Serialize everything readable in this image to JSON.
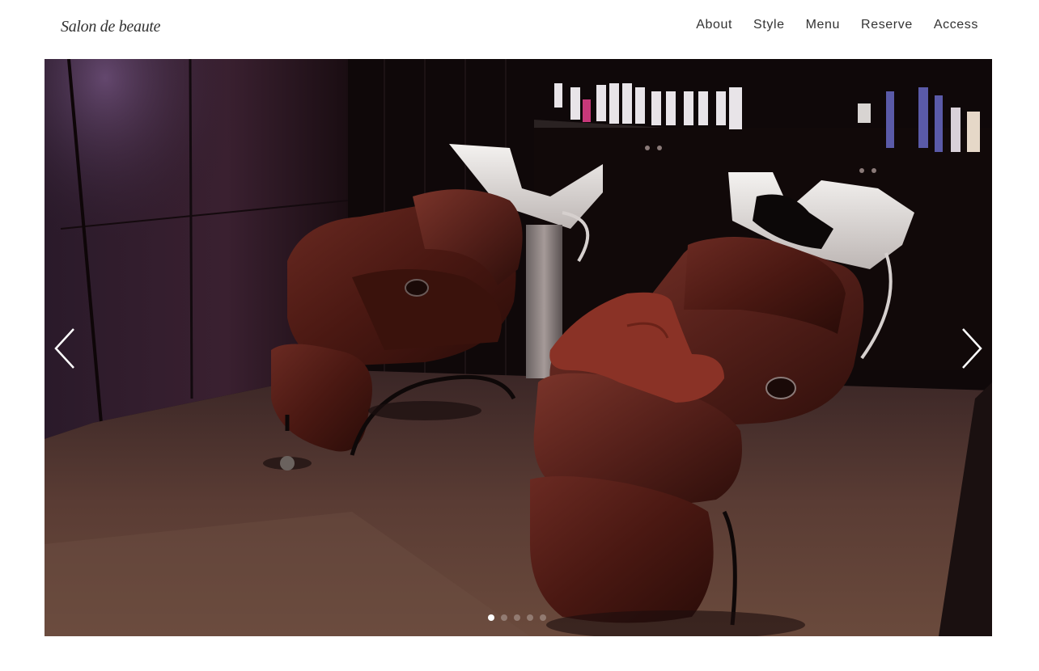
{
  "site": {
    "logo": "Salon de beaute"
  },
  "nav": {
    "items": [
      {
        "label": "About"
      },
      {
        "label": "Style"
      },
      {
        "label": "Menu"
      },
      {
        "label": "Reserve"
      },
      {
        "label": "Access"
      }
    ]
  },
  "slider": {
    "image": "salon-shampoo-chairs-photo",
    "prev_icon": "chevron-left-icon",
    "next_icon": "chevron-right-icon",
    "slide_count": 5,
    "active_slide": 1
  }
}
